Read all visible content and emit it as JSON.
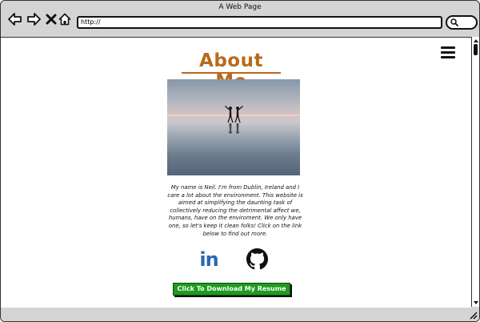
{
  "window": {
    "title": "A Web Page"
  },
  "toolbar": {
    "url": "http://"
  },
  "page": {
    "heading": "About Me",
    "bio": "My name is Neil. I'm from Dublin, Ireland and I care a lot about the environment. This website is aimed at simplifying the daunting task of collectively reducing the detrimental affect we, humans, have on the enviroment. We only have one, so let's keep it clean folks! Click on the link below to find out more.",
    "linkedin_label": "in",
    "resume_button": "Click To Download My Resume"
  },
  "icons": {
    "back": "arrow-left-icon",
    "forward": "arrow-right-icon",
    "stop": "close-icon",
    "home": "home-icon",
    "search": "search-icon",
    "menu": "hamburger-menu-icon",
    "linkedin": "linkedin-icon",
    "github": "github-icon",
    "resize": "resize-grip-icon"
  },
  "colors": {
    "heading": "#b86a1a",
    "linkedin": "#2867b2",
    "button": "#1e9b1e",
    "chrome": "#d4d4d4"
  }
}
